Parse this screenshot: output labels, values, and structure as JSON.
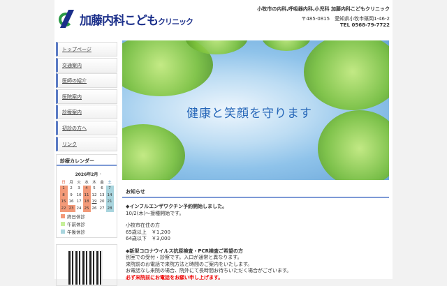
{
  "header": {
    "logo_text": "加藤内科こども",
    "logo_small": "クリニック",
    "tagline": "小牧市の内科,呼吸器内科,小児科 加藤内科こどもクリニック",
    "address": "〒485-0815　愛知県小牧市篠岡1-46-2",
    "tel": "TEL 0568-79-7722"
  },
  "menu": [
    "トップページ",
    "交通案内",
    "医師の紹介",
    "医院案内",
    "診療案内",
    "初診の方へ",
    "リンク"
  ],
  "calendar": {
    "title": "診療カレンダー",
    "month": "2026年2月",
    "next": "›",
    "weekdays": [
      "日",
      "月",
      "火",
      "水",
      "木",
      "金",
      "土"
    ],
    "weeks": [
      [
        "1",
        "2",
        "3",
        "4",
        "5",
        "6",
        "7"
      ],
      [
        "8",
        "9",
        "10",
        "11",
        "12",
        "13",
        "14"
      ],
      [
        "15",
        "16",
        "17",
        "18",
        "19",
        "20",
        "21"
      ],
      [
        "22",
        "23",
        "24",
        "25",
        "26",
        "27",
        "28"
      ]
    ],
    "closed_all_day": [
      "1",
      "4",
      "8",
      "11",
      "15",
      "18",
      "22",
      "23",
      "25"
    ],
    "closed_pm": [
      "7",
      "14",
      "21",
      "28"
    ],
    "today": "19",
    "legend": [
      {
        "label": "終日休診",
        "color": "#f39a79"
      },
      {
        "label": "午前休診",
        "color": "#c6ef9a"
      },
      {
        "label": "午後休診",
        "color": "#a9d5de"
      }
    ]
  },
  "hero": {
    "text": "健康と笑顔を守ります"
  },
  "news": {
    "title": "お知らせ",
    "lines": [
      {
        "t": "◆インフルエンザワクチン予約開始しました。",
        "c": "h"
      },
      {
        "t": "10/2(木)〜接種開始です。",
        "c": ""
      },
      {
        "t": "",
        "c": "sp"
      },
      {
        "t": "小牧市在住の方",
        "c": ""
      },
      {
        "t": "65歳以上　￥1,200",
        "c": ""
      },
      {
        "t": "64歳以下　￥3,000",
        "c": ""
      },
      {
        "t": "",
        "c": "sp"
      },
      {
        "t": "◆新型コロナウイルス抗原検査・PCR検査ご希望の方",
        "c": "h"
      },
      {
        "t": "別室での受付・診察です。入口が通常と異なります。",
        "c": ""
      },
      {
        "t": "来院前のお電話で来院方法と時間のご案内をいたします。",
        "c": ""
      },
      {
        "t": "お電話なし来院の場合、院外にて長時間お待ちいただく場合がございます。",
        "c": ""
      },
      {
        "t": "必ず来院前にお電話をお願い申し上げます。",
        "c": "red"
      }
    ]
  }
}
